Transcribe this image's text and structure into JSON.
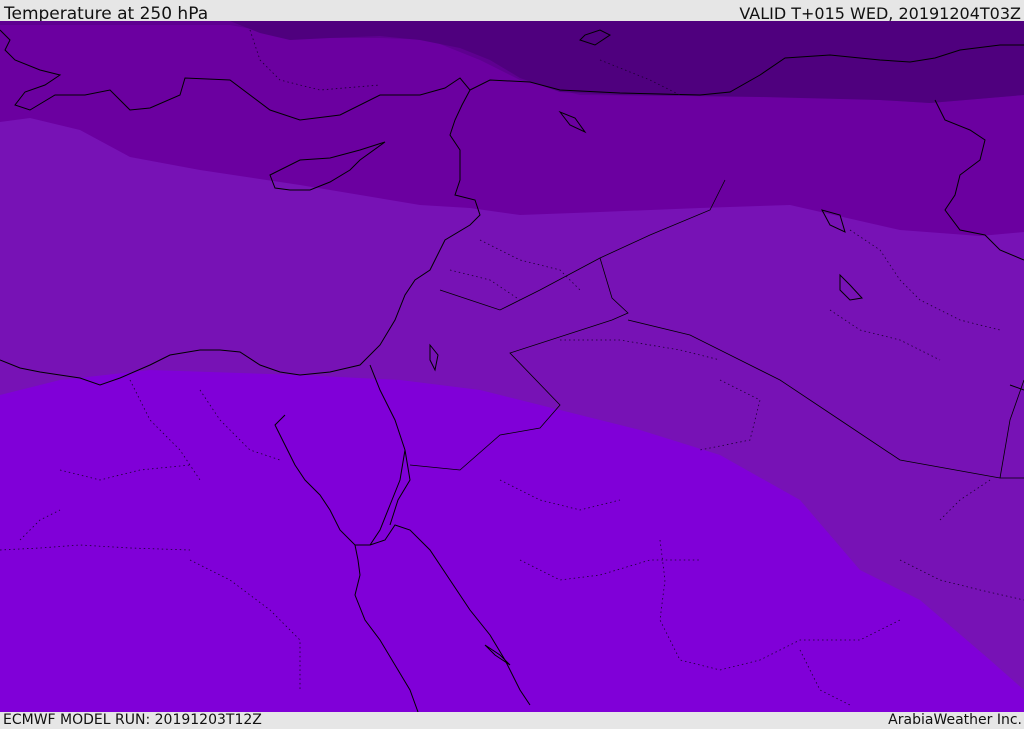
{
  "header": {
    "title": "Temperature at 250 hPa",
    "valid": "VALID T+015 WED, 20191204T03Z"
  },
  "footer": {
    "model_run": "ECMWF MODEL RUN: 20191203T12Z",
    "credit": "ArabiaWeather Inc."
  },
  "map": {
    "bands": [
      {
        "level": 1,
        "color": "#4f007e"
      },
      {
        "level": 2,
        "color": "#5e0090"
      },
      {
        "level": 3,
        "color": "#6b00a0"
      },
      {
        "level": 4,
        "color": "#7712b5"
      },
      {
        "level": 5,
        "color": "#8000d8"
      }
    ],
    "coastline_color": "#000000",
    "border_style": "dotted"
  }
}
